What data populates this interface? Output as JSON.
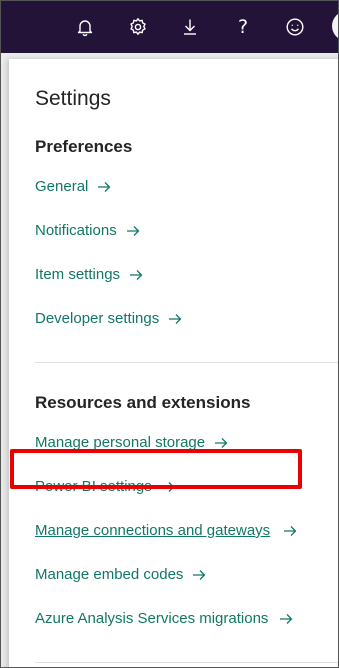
{
  "topbar": {
    "icons": [
      "bell-icon",
      "gear-icon",
      "download-icon",
      "help-icon",
      "smiley-icon",
      "avatar"
    ],
    "help_glyph": "?"
  },
  "panel": {
    "title": "Settings",
    "preferences": {
      "heading": "Preferences",
      "items": [
        {
          "label": "General"
        },
        {
          "label": "Notifications"
        },
        {
          "label": "Item settings"
        },
        {
          "label": "Developer settings"
        }
      ]
    },
    "resources": {
      "heading": "Resources and extensions",
      "items": [
        {
          "label": "Manage personal storage"
        },
        {
          "label": "Power BI settings"
        },
        {
          "label": "Manage connections and gateways",
          "highlighted": true
        },
        {
          "label": "Manage embed codes"
        },
        {
          "label": "Azure Analysis Services migrations"
        }
      ]
    }
  },
  "colors": {
    "topbar_bg": "#241338",
    "link": "#117865",
    "text": "#252423",
    "highlight_border": "#ea0000"
  }
}
